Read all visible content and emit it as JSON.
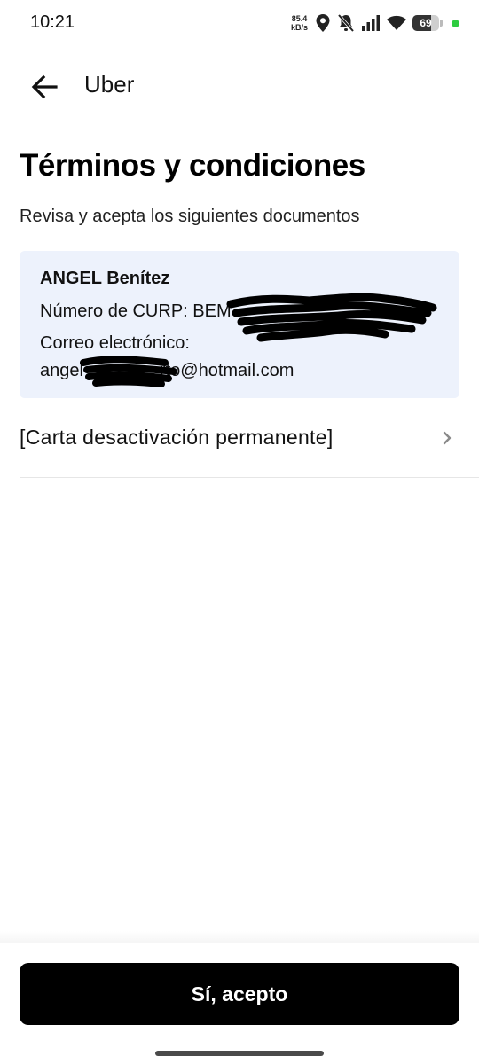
{
  "status_bar": {
    "time": "10:21",
    "net_speed_value": "85.4",
    "net_speed_unit": "kB/s",
    "battery_level": "69",
    "icons": [
      "location-icon",
      "bell-off-icon",
      "signal-icon",
      "wifi-icon",
      "battery-icon",
      "privacy-dot"
    ]
  },
  "nav": {
    "title": "Uber",
    "back_icon": "arrow-left-icon"
  },
  "page": {
    "title": "Términos y condiciones",
    "subtitle": "Revisa y acepta los siguientes documentos"
  },
  "card": {
    "name": "ANGEL Benítez",
    "curp_text": "Número de CURP: BEM",
    "curp_suffix": "00",
    "email_label": "Correo electrónico:",
    "email_prefix": "angel",
    "email_suffix": "rto@hotmail.com"
  },
  "documents": [
    {
      "label": "[Carta desactivación permanente]",
      "icon": "chevron-right-icon"
    }
  ],
  "actions": {
    "accept_label": "Sí, acepto"
  },
  "colors": {
    "card_background": "#edf2fc",
    "button_background": "#000000",
    "privacy_dot": "#2ecc40"
  }
}
